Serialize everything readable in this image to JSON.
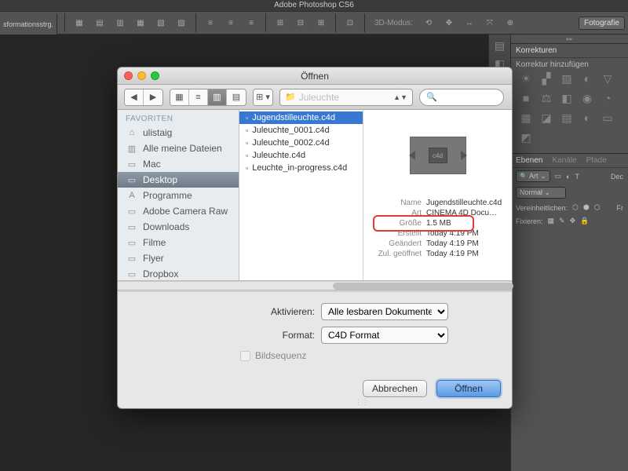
{
  "app": {
    "title": "Adobe Photoshop CS6"
  },
  "toolOptions": {
    "transform_label": "sformationsstrg.",
    "mode_label": "3D-Modus:",
    "right_button": "Fotografie"
  },
  "rightPanels": {
    "korrekturen_tab": "Korrekturen",
    "korrektur_hint": "Korrektur hinzufügen",
    "ebenen_tab": "Ebenen",
    "kanale_tab": "Kanäle",
    "pfade_tab": "Pfade",
    "art_label": "Art",
    "dec_label": "Dec",
    "blend_mode": "Normal",
    "vereinheitlichen": "Vereinheitlichen:",
    "fr_label": "Fr",
    "fixieren": "Fixieren:"
  },
  "dialog": {
    "title": "Öffnen",
    "path_current": "Juleuchte",
    "search_placeholder": "",
    "sidebar": {
      "section": "FAVORITEN",
      "items": [
        {
          "label": "ulistaig",
          "icon": "⌂"
        },
        {
          "label": "Alle meine Dateien",
          "icon": "▥"
        },
        {
          "label": "Mac",
          "icon": "▭"
        },
        {
          "label": "Desktop",
          "icon": "▭",
          "selected": true
        },
        {
          "label": "Programme",
          "icon": "A"
        },
        {
          "label": "Adobe Camera Raw",
          "icon": "▭"
        },
        {
          "label": "Downloads",
          "icon": "▭"
        },
        {
          "label": "Filme",
          "icon": "▭"
        },
        {
          "label": "Flyer",
          "icon": "▭"
        },
        {
          "label": "Dropbox",
          "icon": "▭"
        }
      ]
    },
    "files": [
      {
        "name": "Jugendstilleuchte.c4d",
        "selected": true
      },
      {
        "name": "Juleuchte_0001.c4d"
      },
      {
        "name": "Juleuchte_0002.c4d"
      },
      {
        "name": "Juleuchte.c4d"
      },
      {
        "name": "Leuchte_in-progress.c4d"
      }
    ],
    "preview": {
      "thumb_badge": "c4d",
      "meta": [
        {
          "k": "Name",
          "v": "Jugendstilleuchte.c4d"
        },
        {
          "k": "Art",
          "v": "CINEMA 4D Docu…"
        },
        {
          "k": "Größe",
          "v": "1.5 MB",
          "hl": true
        },
        {
          "k": "Erstellt",
          "v": "Today 4:19 PM"
        },
        {
          "k": "Geändert",
          "v": "Today 4:19 PM"
        },
        {
          "k": "Zul. geöffnet",
          "v": "Today 4:19 PM"
        }
      ]
    },
    "options": {
      "activate_label": "Aktivieren:",
      "activate_value": "Alle lesbaren Dokumente",
      "format_label": "Format:",
      "format_value": "C4D Format",
      "seq_label": "Bildsequenz"
    },
    "buttons": {
      "cancel": "Abbrechen",
      "open": "Öffnen"
    }
  }
}
